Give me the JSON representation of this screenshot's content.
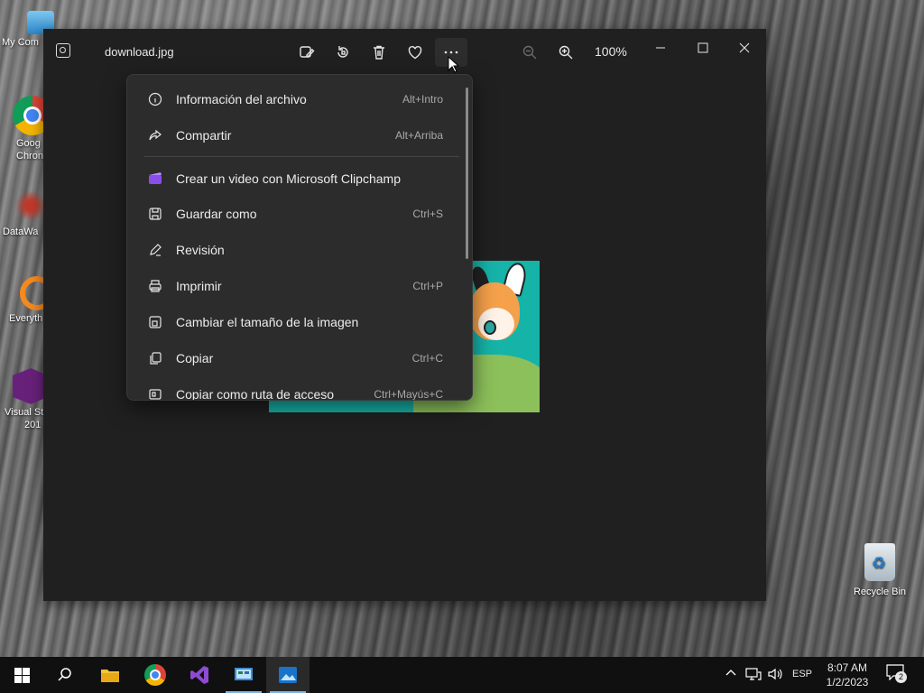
{
  "desktop": {
    "icons": [
      {
        "label": "My Com",
        "name": "desktop-icon-my-computer"
      },
      {
        "label": "Goog",
        "label2": "Chron",
        "name": "desktop-icon-google-chrome"
      },
      {
        "label": "DataWa",
        "name": "desktop-icon-datawarrior"
      },
      {
        "label": "Everyth",
        "name": "desktop-icon-everything"
      },
      {
        "label": "Visual St",
        "label2": "201",
        "name": "desktop-icon-visual-studio"
      }
    ],
    "recycle_bin_label": "Recycle Bin"
  },
  "window": {
    "filename": "download.jpg",
    "zoom": "100%",
    "toolbar_icons": [
      "edit-image-icon",
      "rotate-icon",
      "delete-icon",
      "favorite-icon",
      "more-icon",
      "zoom-out-icon",
      "zoom-in-icon"
    ]
  },
  "menu": {
    "items": [
      {
        "label": "Información del archivo",
        "shortcut": "Alt+Intro",
        "icon": "info-icon"
      },
      {
        "label": "Compartir",
        "shortcut": "Alt+Arriba",
        "icon": "share-icon"
      },
      {
        "label": "Crear un video con Microsoft Clipchamp",
        "shortcut": "",
        "icon": "clipchamp-icon"
      },
      {
        "label": "Guardar como",
        "shortcut": "Ctrl+S",
        "icon": "save-icon"
      },
      {
        "label": "Revisión",
        "shortcut": "",
        "icon": "markup-icon"
      },
      {
        "label": "Imprimir",
        "shortcut": "Ctrl+P",
        "icon": "print-icon"
      },
      {
        "label": "Cambiar el tamaño de la imagen",
        "shortcut": "",
        "icon": "resize-icon"
      },
      {
        "label": "Copiar",
        "shortcut": "Ctrl+C",
        "icon": "copy-icon"
      },
      {
        "label": "Copiar como ruta de acceso",
        "shortcut": "Ctrl+Mayús+C",
        "icon": "copy-path-icon"
      }
    ]
  },
  "taskbar": {
    "apps": [
      "start-icon",
      "search-icon",
      "file-explorer-icon",
      "chrome-icon",
      "visual-studio-icon",
      "control-panel-icon",
      "photos-icon"
    ],
    "language": "ESP",
    "time": "8:07 AM",
    "date": "1/2/2023",
    "notifications_count": "2"
  },
  "colors": {
    "window_bg": "#202020",
    "menu_bg": "#2c2c2c",
    "taskbar_bg": "#101010",
    "accent": "#7fb4e8"
  }
}
